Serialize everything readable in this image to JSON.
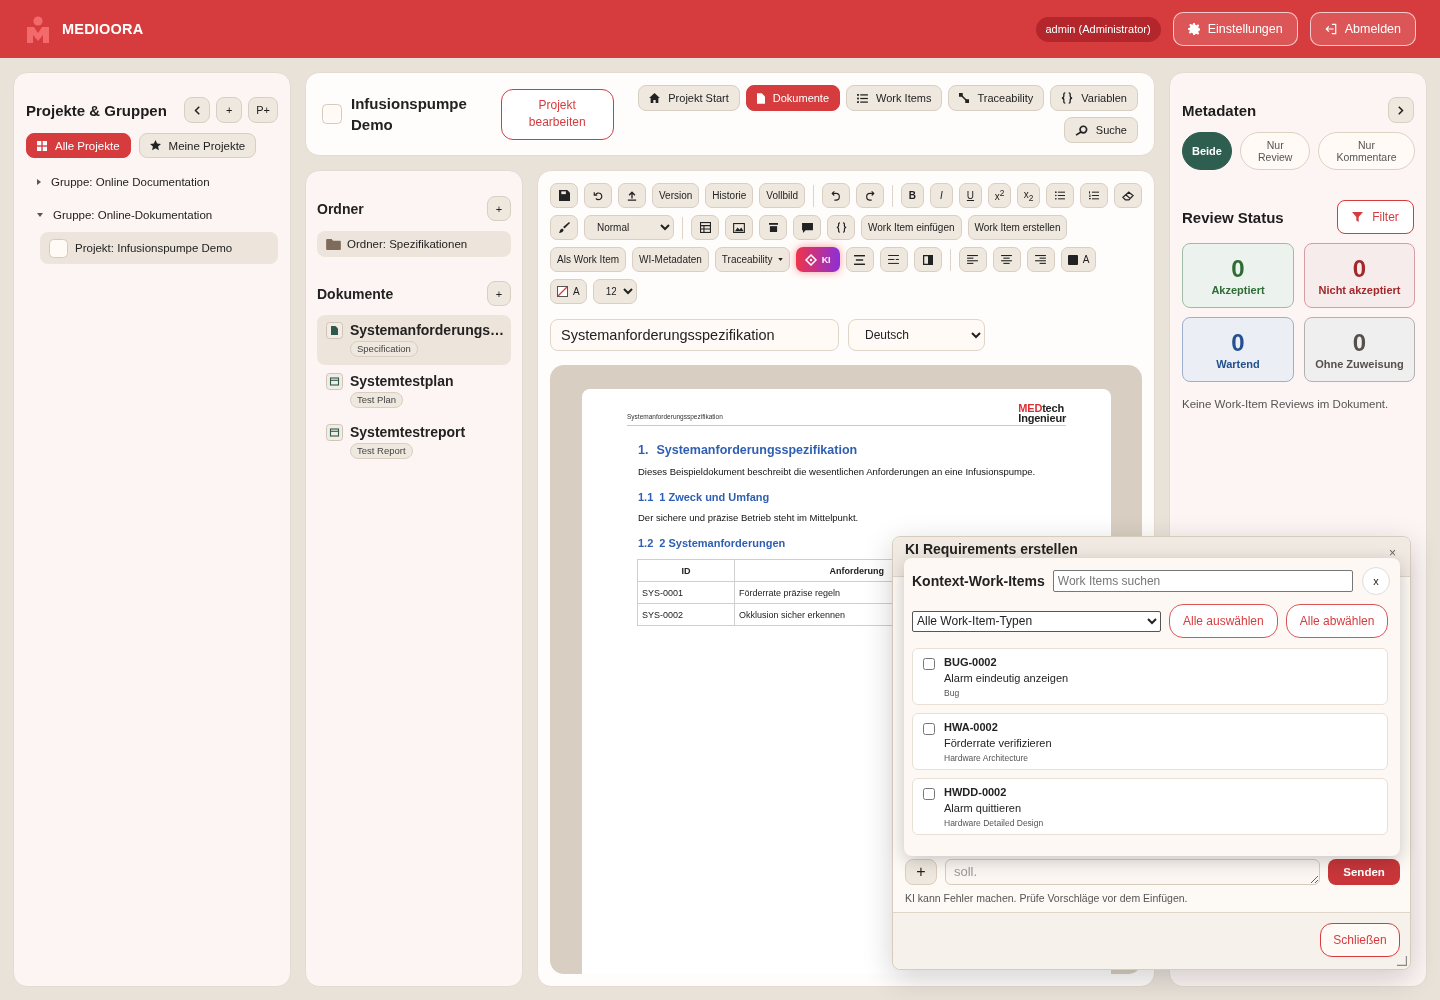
{
  "app_bar": {
    "brand": "MEDIOORA",
    "user": "admin (Administrator)",
    "settings_button": "Einstellungen",
    "logout_button": "Abmelden"
  },
  "projects_sidebar": {
    "title": "Projekte & Gruppen",
    "add_button": "+",
    "add_project_button": "P+",
    "tabs": [
      {
        "label": "Alle Projekte",
        "selected": true
      },
      {
        "label": "Meine Projekte",
        "selected": false
      }
    ],
    "tree": [
      {
        "label": "Gruppe: Online Documentation",
        "expanded": false
      },
      {
        "label": "Gruppe: Online-Dokumentation",
        "expanded": true,
        "children": [
          {
            "label": "Projekt: Infusionspumpe Demo",
            "selected": true
          }
        ]
      }
    ]
  },
  "project_header": {
    "title": "Infusionspumpe Demo",
    "edit_button": "Projekt bearbeiten",
    "nav": [
      {
        "label": "Projekt Start",
        "selected": false
      },
      {
        "label": "Dokumente",
        "selected": true
      },
      {
        "label": "Work Items",
        "selected": false
      },
      {
        "label": "Traceability",
        "selected": false
      },
      {
        "label": "Variablen",
        "selected": false
      },
      {
        "label": "Suche",
        "selected": false
      }
    ]
  },
  "folders": {
    "title": "Ordner",
    "add_button": "+",
    "items": [
      {
        "label": "Ordner: Spezifikationen",
        "selected": true
      }
    ]
  },
  "documents": {
    "title": "Dokumente",
    "add_button": "+",
    "items": [
      {
        "kind": "spec",
        "title": "Systemanforderungs…",
        "type": "Specification",
        "selected": true
      },
      {
        "kind": "test",
        "title": "Systemtestplan",
        "type": "Test Plan",
        "selected": false
      },
      {
        "kind": "test",
        "title": "Systemtestreport",
        "type": "Test Report",
        "selected": false
      }
    ]
  },
  "editor": {
    "toolbar": {
      "history_buttons": [
        "Version",
        "Historie",
        "Vollbild"
      ],
      "format_buttons": [
        "B",
        "I",
        "U",
        "x$^{2}$",
        "x$_{2}$"
      ],
      "paragraph_style": "Normal",
      "work_item_buttons": [
        "Work Item einfügen",
        "Work Item erstellen"
      ],
      "convert_buttons": [
        "Als Work Item",
        "WI-Metadaten"
      ],
      "traceability_menu": "Traceability",
      "ai_button": "KI",
      "text_color_button": "A",
      "highlight_button": "A",
      "font_size": "12"
    },
    "title_field": "Systemanforderungsspezifikation",
    "language": "Deutsch",
    "page": {
      "header_title": "Systemanforderungsspezifikation",
      "logo": {
        "accent": "MED",
        "text": "tech",
        "line_2": "Ingenieur"
      },
      "heading": {
        "number": "1.",
        "text": "Systemanforderungsspezifikation"
      },
      "intro": "Dieses Beispieldokument beschreibt die wesentlichen Anforderungen an eine Infusionspumpe.",
      "sections": [
        {
          "number": "1.1",
          "title": "1 Zweck und Umfang",
          "text": "Der sichere und präzise Betrieb steht im Mittelpunkt."
        },
        {
          "number": "1.2",
          "title": "2 Systemanforderungen"
        }
      ],
      "table": {
        "columns": [
          "ID",
          "Anforderung"
        ],
        "rows": [
          [
            "SYS-0001",
            "Förderrate präzise regeln"
          ],
          [
            "SYS-0002",
            "Okklusion sicher erkennen"
          ]
        ]
      }
    }
  },
  "review_panel": {
    "title": "Metadaten",
    "view_filter": [
      {
        "label": "Beide",
        "selected": true
      },
      {
        "label": "Nur Review",
        "selected": false
      },
      {
        "label": "Nur Kommentare",
        "selected": false
      }
    ],
    "review_status": {
      "title": "Review Status",
      "filter_button": "Filter",
      "cards": [
        {
          "count": "0",
          "label": "Akzeptiert",
          "color": "#2e6b35"
        },
        {
          "count": "0",
          "label": "Nicht akzeptiert",
          "color": "#a3282c"
        },
        {
          "count": "0",
          "label": "Wartend",
          "color": "#24508f"
        },
        {
          "count": "0",
          "label": "Ohne Zuweisung",
          "color": "#55504a"
        }
      ]
    },
    "empty_note": "Keine Work-Item Reviews im Dokument."
  },
  "ai_dialog": {
    "title": "KI Requirements erstellen",
    "close": "×",
    "context_picker": {
      "title": "Kontext-Work-Items",
      "search_placeholder": "Work Items suchen",
      "close_button": "x",
      "type_filter": "Alle Work-Item-Typen",
      "select_all": "Alle auswählen",
      "deselect_all": "Alle abwählen",
      "items": [
        {
          "id": "BUG-0002",
          "title": "Alarm eindeutig anzeigen",
          "type": "Bug",
          "checked": false
        },
        {
          "id": "HWA-0002",
          "title": "Förderrate verifizieren",
          "type": "Hardware Architecture",
          "checked": false
        },
        {
          "id": "HWDD-0002",
          "title": "Alarm quittieren",
          "type": "Hardware Detailed Design",
          "checked": false
        }
      ]
    },
    "composer": {
      "add_button": "+",
      "placeholder": "soll.",
      "send_button": "Senden"
    },
    "disclaimer": "KI kann Fehler machen. Prüfe Vorschläge vor dem Einfügen.",
    "close_button": "Schließen"
  }
}
